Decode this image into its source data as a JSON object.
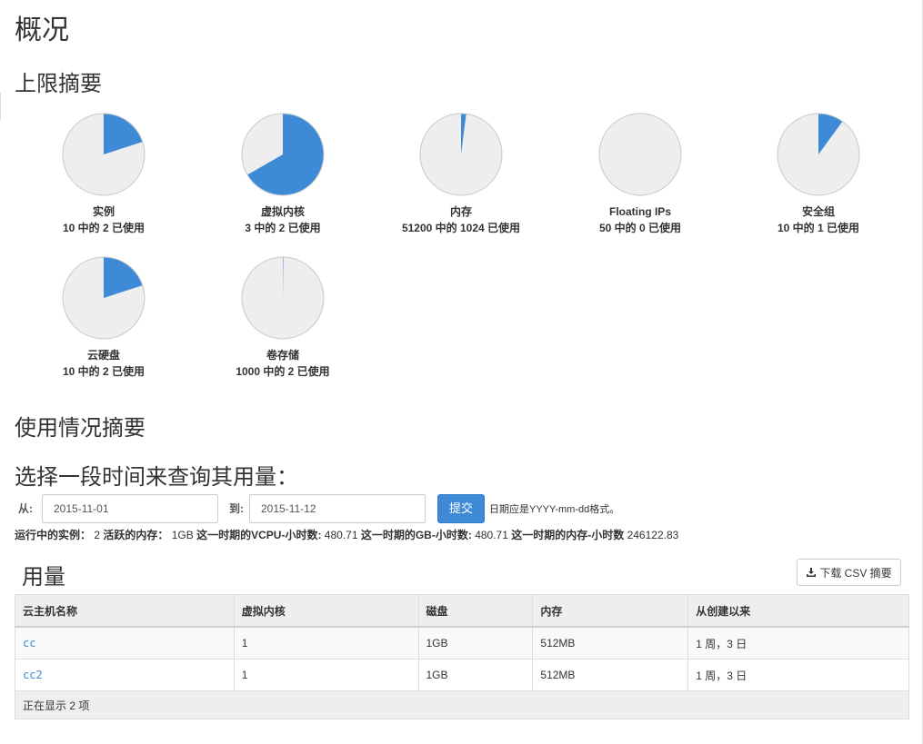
{
  "page_title": "概况",
  "quota": {
    "section_title": "上限摘要",
    "items": [
      {
        "label": "实例",
        "usage": "10 中的 2 已使用",
        "used": 2,
        "total": 10
      },
      {
        "label": "虚拟内核",
        "usage": "3 中的 2 已使用",
        "used": 2,
        "total": 3
      },
      {
        "label": "内存",
        "usage": "51200 中的 1024 已使用",
        "used": 1024,
        "total": 51200
      },
      {
        "label": "Floating IPs",
        "usage": "50 中的 0 已使用",
        "used": 0,
        "total": 50
      },
      {
        "label": "安全组",
        "usage": "10 中的 1 已使用",
        "used": 1,
        "total": 10
      },
      {
        "label": "云硬盘",
        "usage": "10 中的 2 已使用",
        "used": 2,
        "total": 10
      },
      {
        "label": "卷存储",
        "usage": "1000 中的 2 已使用",
        "used": 2,
        "total": 1000
      }
    ],
    "used_color": "#3e8ad6",
    "free_color": "#eeeeee"
  },
  "usage_summary": {
    "section_title": "使用情况摘要",
    "query_title": "选择一段时间来查询其用量：",
    "from_label": "从:",
    "from_value": "2015-11-01",
    "to_label": "到:",
    "to_value": "2015-11-12",
    "submit_label": "提交",
    "date_hint": "日期应是YYYY-mm-dd格式。",
    "stats": {
      "running_label": "运行中的实例：",
      "running_value": "2",
      "memory_label": "活跃的内存：",
      "memory_value": "1GB",
      "vcpu_label": "这一时期的VCPU-小时数:",
      "vcpu_value": "480.71",
      "gb_label": "这一时期的GB-小时数:",
      "gb_value": "480.71",
      "mem_hours_label": "这一时期的内存-小时数",
      "mem_hours_value": "246122.83"
    }
  },
  "usage": {
    "title": "用量",
    "csv_button": "下载 CSV 摘要",
    "columns": [
      "云主机名称",
      "虚拟内核",
      "磁盘",
      "内存",
      "从创建以来"
    ],
    "rows": [
      {
        "name": "cc",
        "vcpus": "1",
        "disk": "1GB",
        "ram": "512MB",
        "age": "1 周，3 日"
      },
      {
        "name": "cc2",
        "vcpus": "1",
        "disk": "1GB",
        "ram": "512MB",
        "age": "1 周，3 日"
      }
    ],
    "footer": "正在显示 2 项"
  }
}
